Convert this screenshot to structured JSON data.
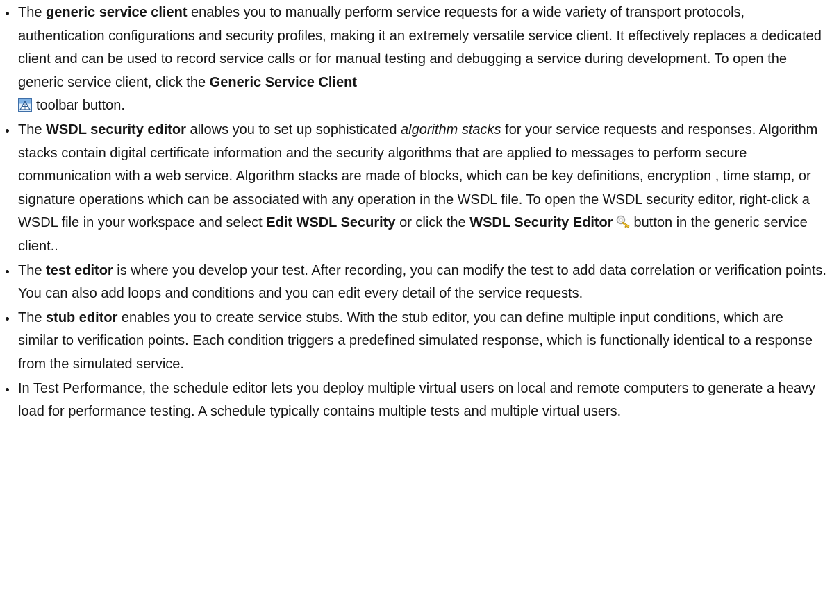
{
  "items": [
    {
      "p1": "The ",
      "b1": "generic service client",
      "p2": " enables you to manually perform service requests for a wide variety of transport protocols, authentication configurations and security profiles, making it an extremely versatile service client. It effectively replaces a dedicated client and can be used to record service calls or for manual testing and debugging a service during development. To open the generic service client, click the ",
      "b2": "Generic Service Client",
      "p3": "toolbar button.",
      "icon": "generic-service-client-icon"
    },
    {
      "p1": "The ",
      "b1": "WSDL security editor",
      "p2": " allows you to set up sophisticated ",
      "i1": "algorithm stacks",
      "p3": " for your service requests and responses. Algorithm stacks contain digital certificate information and the security algorithms that are applied to messages to perform secure communication with a web service. Algorithm stacks are made of blocks, which can be key definitions, encryption , time stamp, or signature operations which can be associated with any operation in the WSDL file. To open the WSDL security editor, right-click a WSDL file in your workspace and select ",
      "b2": "Edit WSDL Security",
      "p4": " or click the ",
      "b3": "WSDL Security Editor",
      "p5": "button in the generic service client..",
      "icon": "key-icon"
    },
    {
      "p1": "The ",
      "b1": "test editor",
      "p2": " is where you develop your test. After recording, you can modify the test to add data correlation or verification points. You can also add loops and conditions and you can edit every detail of the service requests."
    },
    {
      "p1": "The ",
      "b1": "stub editor",
      "p2": " enables you to create service stubs. With the stub editor, you can define multiple input conditions, which are similar to verification points. Each condition triggers a predefined simulated response, which is functionally identical to a response from the simulated service."
    },
    {
      "p1": "In Test Performance, the schedule editor lets you deploy multiple virtual users on local and remote computers to generate a heavy load for performance testing. A schedule typically contains multiple tests and multiple virtual users."
    }
  ]
}
